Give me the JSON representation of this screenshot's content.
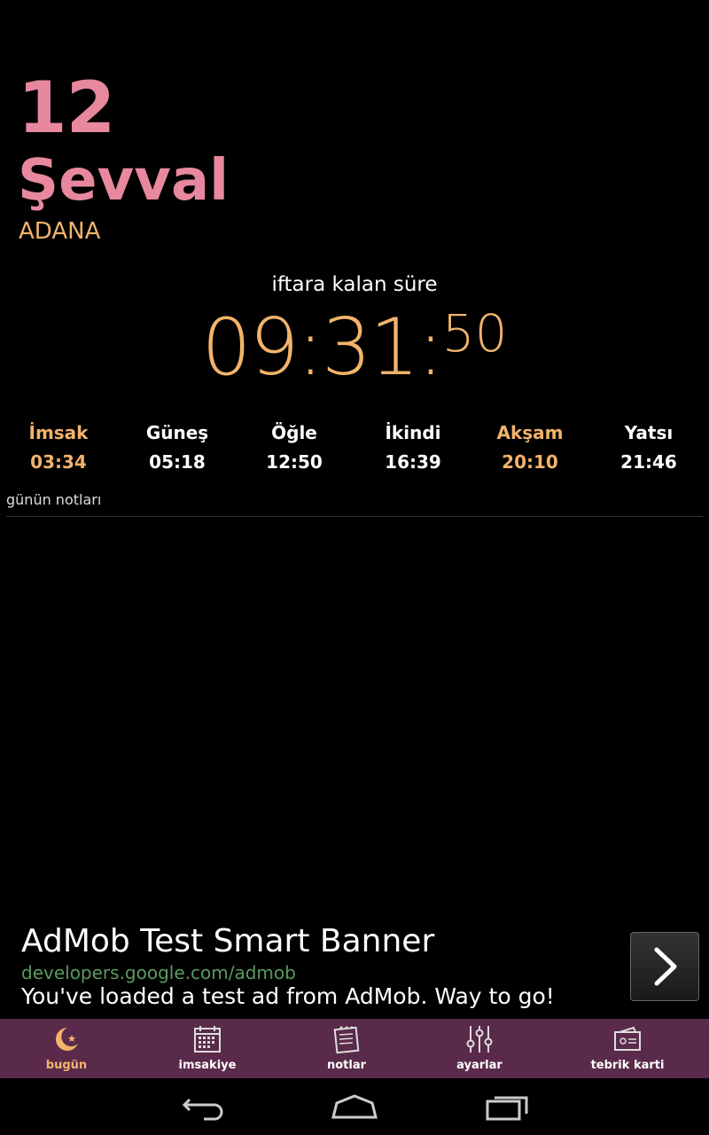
{
  "hijri": {
    "day": "12",
    "month": "Şevval"
  },
  "location": "ADANA",
  "countdown": {
    "label": "iftara kalan süre",
    "hours_minutes": "09:31:",
    "seconds": "50"
  },
  "prayers": [
    {
      "name": "İmsak",
      "time": "03:34",
      "highlighted": true
    },
    {
      "name": "Güneş",
      "time": "05:18",
      "highlighted": false
    },
    {
      "name": "Öğle",
      "time": "12:50",
      "highlighted": false
    },
    {
      "name": "İkindi",
      "time": "16:39",
      "highlighted": false
    },
    {
      "name": "Akşam",
      "time": "20:10",
      "highlighted": true
    },
    {
      "name": "Yatsı",
      "time": "21:46",
      "highlighted": false
    }
  ],
  "notes_label": "günün notları",
  "ad": {
    "title": "AdMob Test Smart Banner",
    "url": "developers.google.com/admob",
    "description": "You've loaded a test ad from AdMob. Way to go!",
    "arrow_icon": "chevron-right-icon"
  },
  "tabs": [
    {
      "label": "bugün",
      "icon": "moon-star-icon",
      "active": true
    },
    {
      "label": "imsakiye",
      "icon": "calendar-icon",
      "active": false
    },
    {
      "label": "notlar",
      "icon": "notepad-icon",
      "active": false
    },
    {
      "label": "ayarlar",
      "icon": "sliders-icon",
      "active": false
    },
    {
      "label": "tebrik karti",
      "icon": "greeting-card-icon",
      "active": false
    }
  ],
  "system_nav": {
    "back": "back-icon",
    "home": "home-icon",
    "recents": "recents-icon"
  },
  "colors": {
    "pink": "#e8889e",
    "orange": "#f2b36b",
    "tabbar": "#5a2a4a",
    "background": "#000000"
  }
}
